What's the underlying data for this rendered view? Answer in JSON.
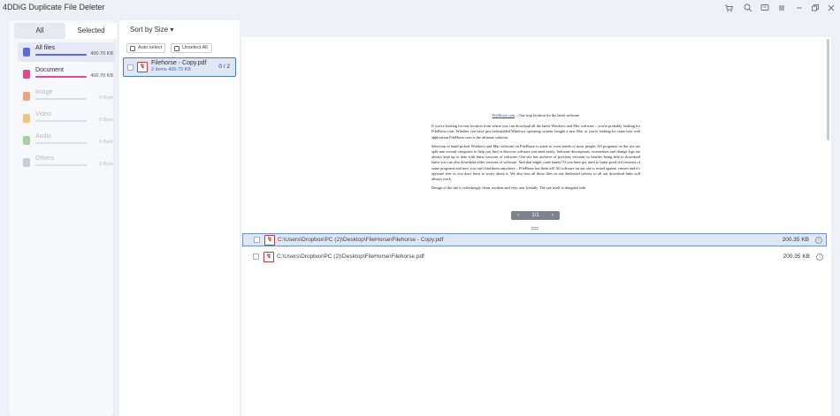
{
  "app": {
    "title": "4DDiG Duplicate File Deleter"
  },
  "window_controls": [
    {
      "name": "cart-icon",
      "icon": "cart"
    },
    {
      "name": "search-icon",
      "icon": "search"
    },
    {
      "name": "feedback-icon",
      "icon": "message"
    },
    {
      "name": "menu-icon",
      "icon": "menu"
    },
    {
      "name": "minimize-icon",
      "icon": "minimize"
    },
    {
      "name": "restore-icon",
      "icon": "restore"
    },
    {
      "name": "close-icon",
      "icon": "close"
    }
  ],
  "tabs": {
    "all": "All",
    "selected": "Selected"
  },
  "categories": [
    {
      "name": "All files",
      "size": "400.70 KB",
      "color": "#5b6bd8",
      "fill": 1.0,
      "enabled": true,
      "selected": true
    },
    {
      "name": "Document",
      "size": "400.70 KB",
      "color": "#e24a8d",
      "fill": 1.0,
      "enabled": true,
      "selected": false
    },
    {
      "name": "Image",
      "size": "0 Byte",
      "color": "#f3a07f",
      "fill": 0,
      "enabled": false,
      "selected": false
    },
    {
      "name": "Video",
      "size": "0 Byte",
      "color": "#f3c37f",
      "fill": 0,
      "enabled": false,
      "selected": false
    },
    {
      "name": "Audio",
      "size": "0 Byte",
      "color": "#9fd39a",
      "fill": 0,
      "enabled": false,
      "selected": false
    },
    {
      "name": "Others",
      "size": "0 Byte",
      "color": "#c9ccd5",
      "fill": 0,
      "enabled": false,
      "selected": false
    }
  ],
  "sort": {
    "label": "Sort by Size ▾"
  },
  "toolbar": {
    "auto_select": "Auto select",
    "unselect_all": "Unselect All"
  },
  "group": {
    "name": "Filehorse - Copy.pdf",
    "meta": "2 items   400.70 KB",
    "count": "0 / 2"
  },
  "preview": {
    "header_link": "FileHorse.com",
    "header_rest": " – One stop location for the latest software",
    "p1": "If you're looking for one location from where you can download all the latest Windows and Mac software – you're probably looking for FileHorse.com. Whether you have just (re)installed Windows operating system, bought a new Mac or you're looking for some new web application FileHorse.com is the ultimate solution.",
    "p2": "Selection of hand-picked Windows and Mac software on FileHorse is made to cover needs of most people. All programs on the site are split into several categories to help you find or discover software you need easily. Software descriptions, screenshots and change logs are always kept up to date with latest versions of software. Our site has archives of previous versions so besides being able to download latest you can also download older versions of software. And that might come handy! If you have got used to some good old versions of some programs and now you can't find them anywhere – FileHorse has them all! All software on our site is tested against viruses and it's spyware free so you don't have to worry about it. We also host all those files on our dedicated servers so all our download links will always work.",
    "p3": "Design of the site is refreshingly clean, modern and very user friendly. The site itself is designed with",
    "page": "1/1"
  },
  "files": [
    {
      "path": "C:\\Users\\Dropbox\\PC (2)\\Desktop\\FileHorse\\Filehorse - Copy.pdf",
      "size": "200.35 KB"
    },
    {
      "path": "C:\\Users\\Dropbox\\PC (2)\\Desktop\\FileHorse\\Filehorse.pdf",
      "size": "200.35 KB"
    }
  ]
}
